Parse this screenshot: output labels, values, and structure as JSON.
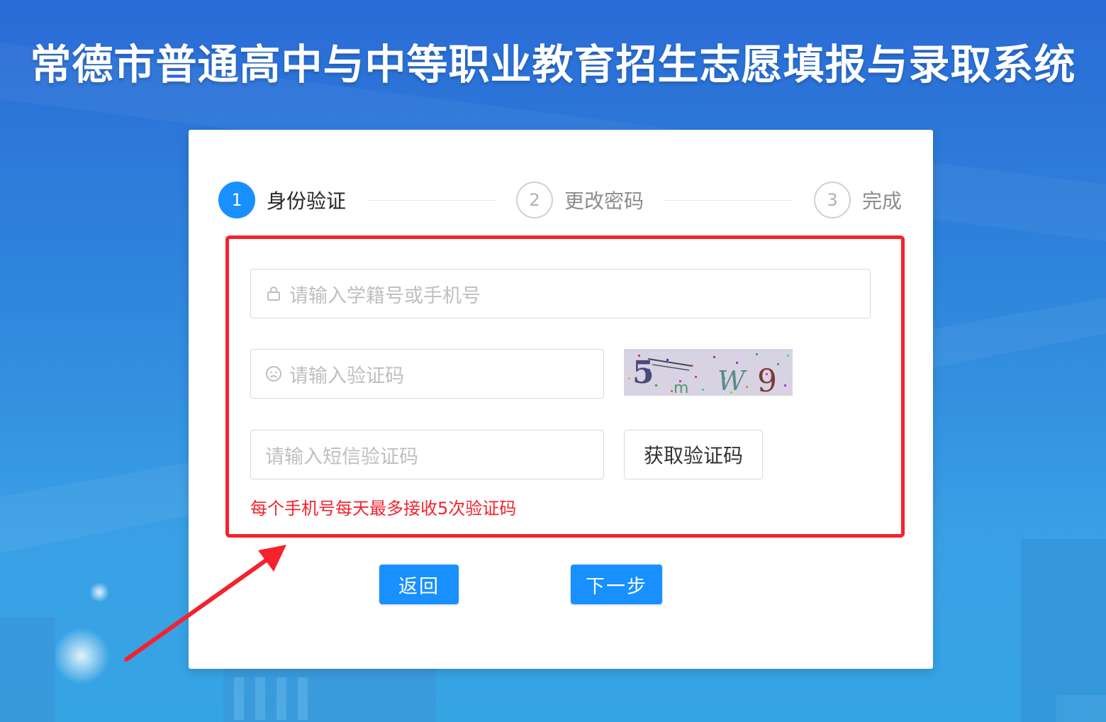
{
  "site_title": "常德市普通高中与中等职业教育招生志愿填报与录取系统",
  "steps": [
    {
      "number": "1",
      "label": "身份验证",
      "active": true
    },
    {
      "number": "2",
      "label": "更改密码",
      "active": false
    },
    {
      "number": "3",
      "label": "完成",
      "active": false
    }
  ],
  "form": {
    "account_placeholder": "请输入学籍号或手机号",
    "captcha_placeholder": "请输入验证码",
    "captcha_image_text": "5m w9",
    "sms_placeholder": "请输入短信验证码",
    "sms_button_label": "获取验证码",
    "sms_limit_notice": "每个手机号每天最多接收5次验证码"
  },
  "actions": {
    "back_label": "返回",
    "next_label": "下一步"
  },
  "colors": {
    "primary": "#1890ff",
    "highlight": "#f5222d",
    "annotation_arrow": "#f5222d"
  }
}
